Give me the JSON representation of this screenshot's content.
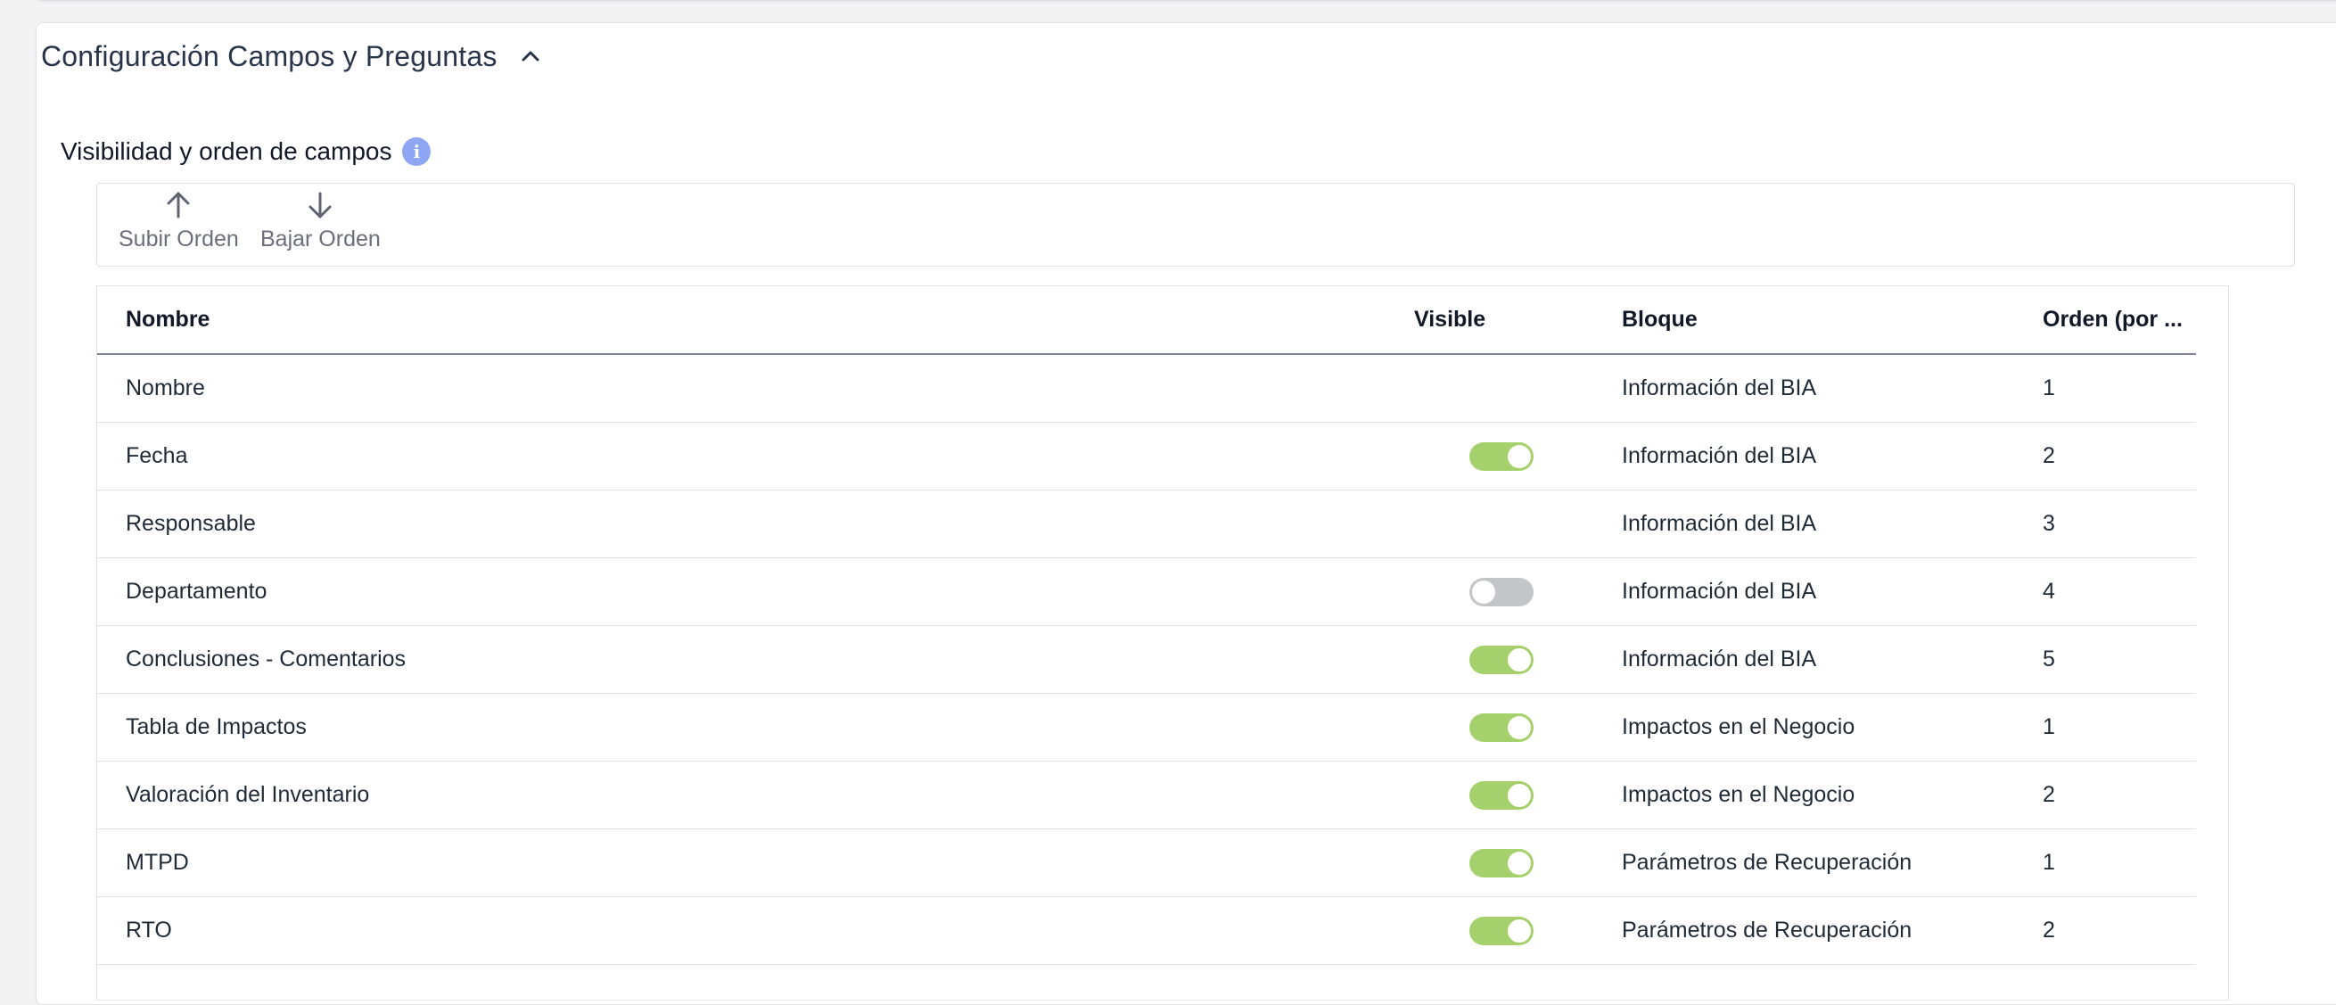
{
  "section": {
    "title": "Configuración Campos y Preguntas",
    "collapse_icon": "chevron-up-icon"
  },
  "subsection": {
    "title": "Visibilidad y orden de campos",
    "info_icon": "info-icon"
  },
  "toolbar": {
    "move_up_label": "Subir Orden",
    "move_up_icon": "arrow-up-icon",
    "move_down_label": "Bajar Orden",
    "move_down_icon": "arrow-down-icon"
  },
  "colors": {
    "toggle_on": "#a5d16c",
    "toggle_off": "#c4c5c8",
    "info_icon": "#8ea6f3"
  },
  "table": {
    "headers": {
      "name": "Nombre",
      "visible": "Visible",
      "bloque": "Bloque",
      "orden": "Orden (por ..."
    },
    "rows": [
      {
        "name": "Nombre",
        "visible": null,
        "bloque": "Información del BIA",
        "orden": "1"
      },
      {
        "name": "Fecha",
        "visible": true,
        "bloque": "Información del BIA",
        "orden": "2"
      },
      {
        "name": "Responsable",
        "visible": null,
        "bloque": "Información del BIA",
        "orden": "3"
      },
      {
        "name": "Departamento",
        "visible": false,
        "bloque": "Información del BIA",
        "orden": "4"
      },
      {
        "name": "Conclusiones - Comentarios",
        "visible": true,
        "bloque": "Información del BIA",
        "orden": "5"
      },
      {
        "name": "Tabla de Impactos",
        "visible": true,
        "bloque": "Impactos en el Negocio",
        "orden": "1"
      },
      {
        "name": "Valoración del Inventario",
        "visible": true,
        "bloque": "Impactos en el Negocio",
        "orden": "2"
      },
      {
        "name": "MTPD",
        "visible": true,
        "bloque": "Parámetros de Recuperación",
        "orden": "1"
      },
      {
        "name": "RTO",
        "visible": true,
        "bloque": "Parámetros de Recuperación",
        "orden": "2"
      }
    ]
  }
}
